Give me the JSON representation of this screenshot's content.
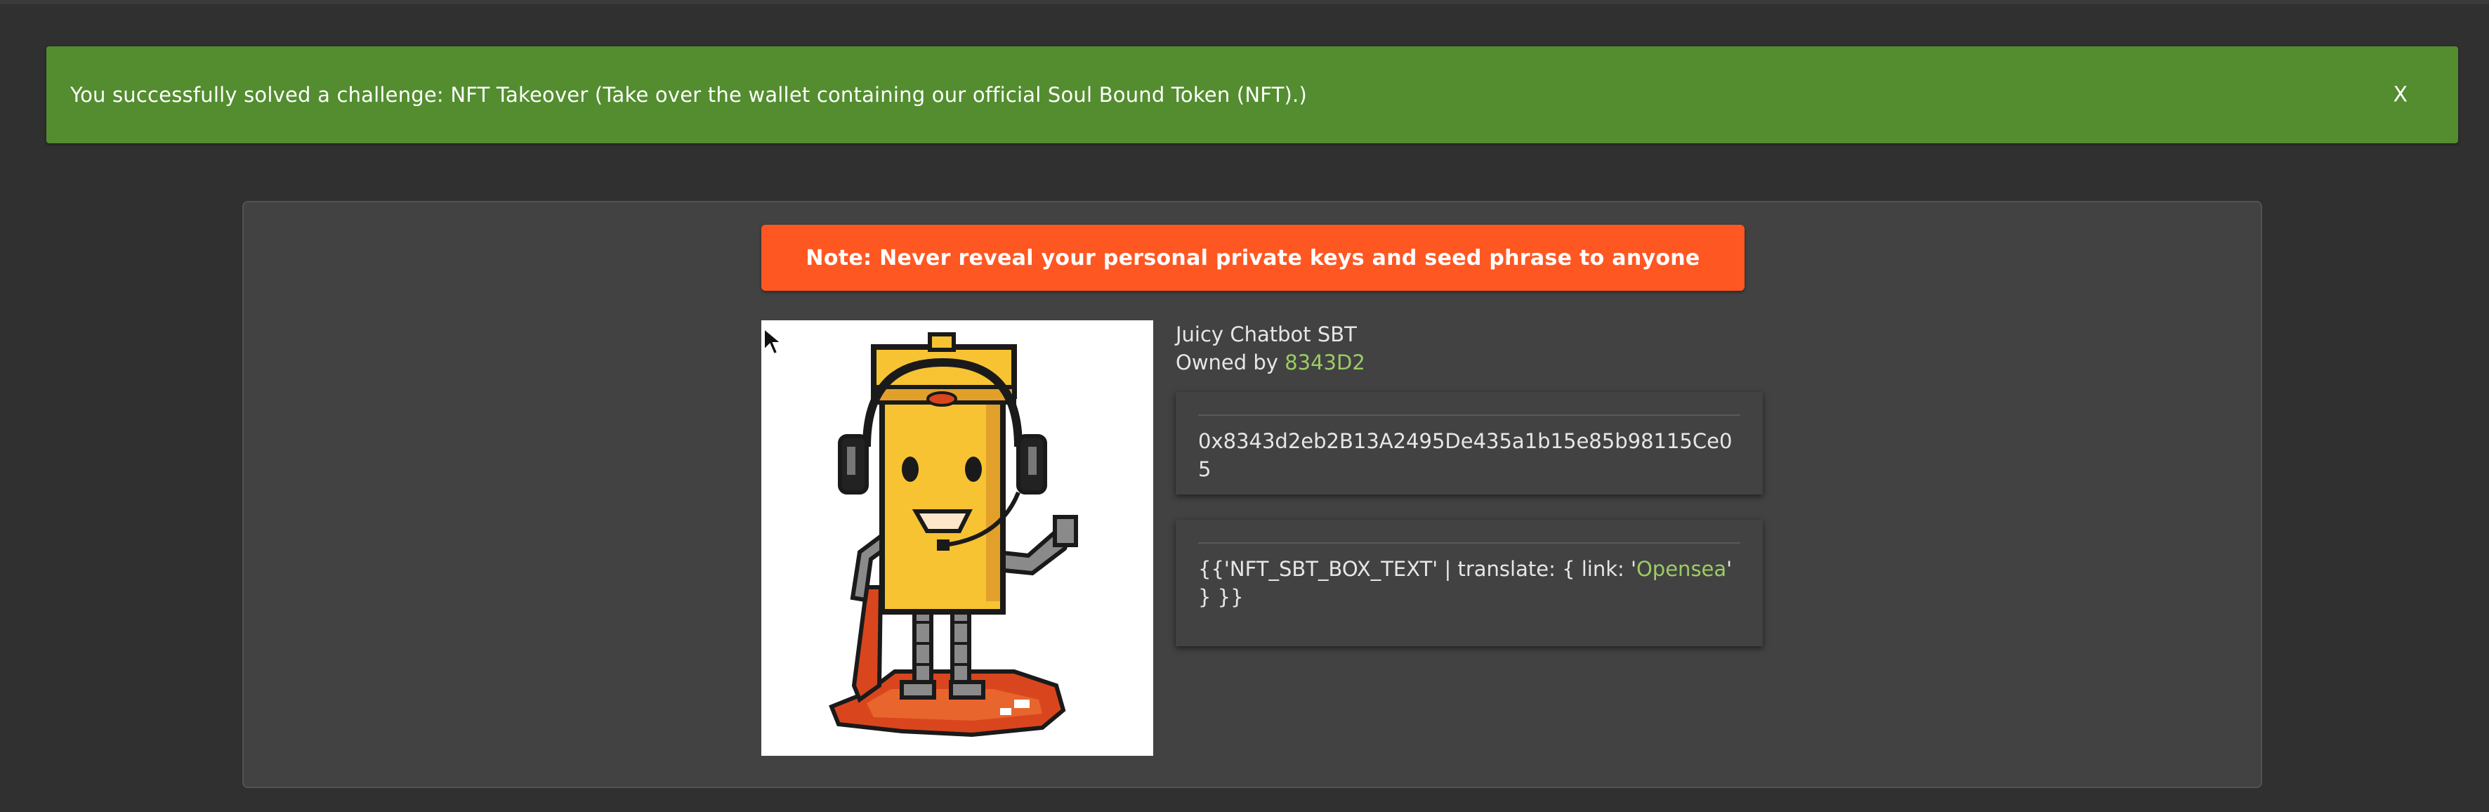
{
  "notification": {
    "text": "You successfully solved a challenge: NFT Takeover (Take over the wallet containing our official Soul Bound Token (NFT).)",
    "close_label": "X",
    "color": "#538d2f"
  },
  "note": {
    "text": "Note: Never reveal your personal private keys and seed phrase to anyone",
    "color": "#ff5722"
  },
  "nft": {
    "title": "Juicy Chatbot SBT",
    "owned_by_prefix": "Owned by ",
    "owner": "8343D2",
    "address": "0x8343d2eb2B13A2495De435a1b15e85b98115Ce05",
    "box_text_prefix": "{{'NFT_SBT_BOX_TEXT' | translate: { link: '",
    "box_text_link": "Opensea",
    "box_text_suffix": "' } }}",
    "image_name": "juicy-chatbot-pixel-art"
  },
  "colors": {
    "background": "#303030",
    "card": "#424242",
    "link": "#9ccc65"
  }
}
